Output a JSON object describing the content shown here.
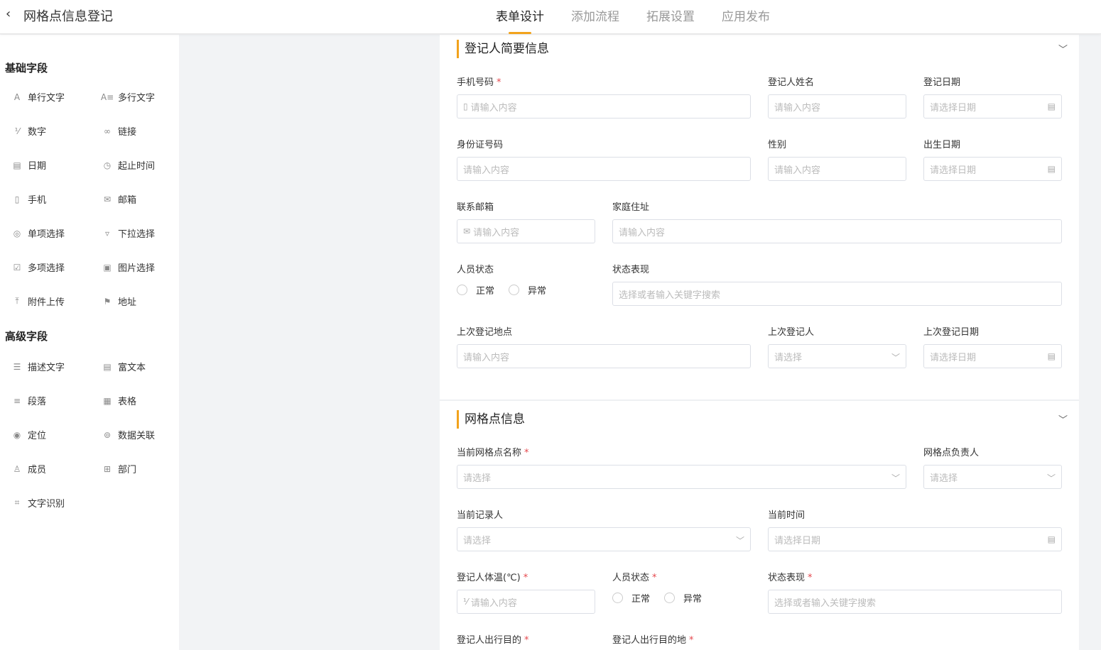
{
  "header": {
    "back_icon": "chevron-left-icon",
    "title": "网格点信息登记",
    "tabs": [
      {
        "label": "表单设计",
        "active": true
      },
      {
        "label": "添加流程",
        "active": false
      },
      {
        "label": "拓展设置",
        "active": false
      },
      {
        "label": "应用发布",
        "active": false
      }
    ]
  },
  "sidebar": {
    "basic_title": "基础字段",
    "basic_items": [
      {
        "label": "单行文字",
        "icon": "single-line-text-icon"
      },
      {
        "label": "多行文字",
        "icon": "multi-line-text-icon"
      },
      {
        "label": "数字",
        "icon": "number-icon"
      },
      {
        "label": "链接",
        "icon": "link-icon"
      },
      {
        "label": "日期",
        "icon": "calendar-icon"
      },
      {
        "label": "起止时间",
        "icon": "time-range-icon"
      },
      {
        "label": "手机",
        "icon": "phone-icon"
      },
      {
        "label": "邮箱",
        "icon": "mail-icon"
      },
      {
        "label": "单项选择",
        "icon": "radio-icon"
      },
      {
        "label": "下拉选择",
        "icon": "dropdown-icon"
      },
      {
        "label": "多项选择",
        "icon": "checkbox-icon"
      },
      {
        "label": "图片选择",
        "icon": "image-icon"
      },
      {
        "label": "附件上传",
        "icon": "upload-icon"
      },
      {
        "label": "地址",
        "icon": "signpost-icon"
      }
    ],
    "advanced_title": "高级字段",
    "advanced_items": [
      {
        "label": "描述文字",
        "icon": "description-icon"
      },
      {
        "label": "富文本",
        "icon": "rich-text-icon"
      },
      {
        "label": "段落",
        "icon": "paragraph-icon"
      },
      {
        "label": "表格",
        "icon": "table-icon"
      },
      {
        "label": "定位",
        "icon": "location-pin-icon"
      },
      {
        "label": "数据关联",
        "icon": "data-link-icon"
      },
      {
        "label": "成员",
        "icon": "user-icon"
      },
      {
        "label": "部门",
        "icon": "org-chart-icon"
      },
      {
        "label": "文字识别",
        "icon": "ocr-scan-icon"
      }
    ]
  },
  "section1": {
    "title": "登记人简要信息",
    "fields": {
      "phone": {
        "label": "手机号码",
        "placeholder": "请输入内容"
      },
      "name": {
        "label": "登记人姓名",
        "placeholder": "请输入内容"
      },
      "reg_date": {
        "label": "登记日期",
        "placeholder": "请选择日期"
      },
      "id_no": {
        "label": "身份证号码",
        "placeholder": "请输入内容"
      },
      "gender": {
        "label": "性别",
        "placeholder": "请输入内容"
      },
      "birth": {
        "label": "出生日期",
        "placeholder": "请选择日期"
      },
      "email": {
        "label": "联系邮箱",
        "placeholder": "请输入内容"
      },
      "address": {
        "label": "家庭住址",
        "placeholder": "请输入内容"
      },
      "status": {
        "label": "人员状态",
        "options": [
          "正常",
          "异常"
        ]
      },
      "status_desc": {
        "label": "状态表现",
        "placeholder": "选择或者输入关键字搜索"
      },
      "last_place": {
        "label": "上次登记地点",
        "placeholder": "请输入内容"
      },
      "last_person": {
        "label": "上次登记人",
        "placeholder": "请选择"
      },
      "last_date": {
        "label": "上次登记日期",
        "placeholder": "请选择日期"
      }
    }
  },
  "section2": {
    "title": "网格点信息",
    "fields": {
      "grid_name": {
        "label": "当前网格点名称",
        "placeholder": "请选择"
      },
      "grid_owner": {
        "label": "网格点负责人",
        "placeholder": "请选择"
      },
      "recorder": {
        "label": "当前记录人",
        "placeholder": "请选择"
      },
      "cur_time": {
        "label": "当前时间",
        "placeholder": "请选择日期"
      },
      "temp": {
        "label": "登记人体温(℃)",
        "placeholder": "请输入内容"
      },
      "status": {
        "label": "人员状态",
        "options": [
          "正常",
          "异常"
        ]
      },
      "status_desc": {
        "label": "状态表现",
        "placeholder": "选择或者输入关键字搜索"
      },
      "purpose": {
        "label": "登记人出行目的"
      },
      "destination": {
        "label": "登记人出行目的地"
      }
    }
  },
  "colors": {
    "accent": "#f2a31c",
    "required": "#e5484d",
    "border": "#dcdfe6"
  }
}
